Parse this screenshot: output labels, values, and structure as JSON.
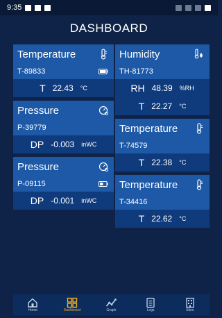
{
  "status_bar": {
    "time": "9:35"
  },
  "header": {
    "title": "DASHBOARD"
  },
  "left_cards": [
    {
      "title": "Temperature",
      "icon": "thermometer-icon",
      "device_id": "T-89833",
      "battery": "battery-full-icon",
      "reading_label": "T",
      "reading_value": "22.43",
      "reading_unit": "°C"
    },
    {
      "title": "Pressure",
      "icon": "gauge-icon",
      "device_id": "P-39779",
      "reading_label": "DP",
      "reading_value": "-0.003",
      "reading_unit": "inWC"
    },
    {
      "title": "Pressure",
      "icon": "gauge-icon",
      "device_id": "P-09115",
      "battery": "battery-half-icon",
      "reading_label": "DP",
      "reading_value": "-0.001",
      "reading_unit": "inWC"
    }
  ],
  "right_cards": [
    {
      "title": "Humidity",
      "icon": "humidity-icon",
      "device_id": "TH-81773",
      "readings": [
        {
          "label": "RH",
          "value": "48.39",
          "unit": "%RH"
        },
        {
          "label": "T",
          "value": "22.27",
          "unit": "°C"
        }
      ]
    },
    {
      "title": "Temperature",
      "icon": "thermometer-icon",
      "device_id": "T-74579",
      "reading_label": "T",
      "reading_value": "22.38",
      "reading_unit": "°C"
    },
    {
      "title": "Temperature",
      "icon": "thermometer-icon",
      "device_id": "T-34416",
      "reading_label": "T",
      "reading_value": "22.62",
      "reading_unit": "°C"
    }
  ],
  "nav": [
    {
      "label": "Home",
      "icon": "home-icon"
    },
    {
      "label": "Dashboard",
      "icon": "dashboard-grid-icon",
      "active": true
    },
    {
      "label": "Graph",
      "icon": "graph-icon"
    },
    {
      "label": "Logs",
      "icon": "logs-icon"
    },
    {
      "label": "Sites",
      "icon": "sites-icon"
    }
  ],
  "colors": {
    "background": "#0e2347",
    "card": "#1d59a6",
    "card_reading": "#0f3b7d",
    "accent": "#f3b21d"
  }
}
